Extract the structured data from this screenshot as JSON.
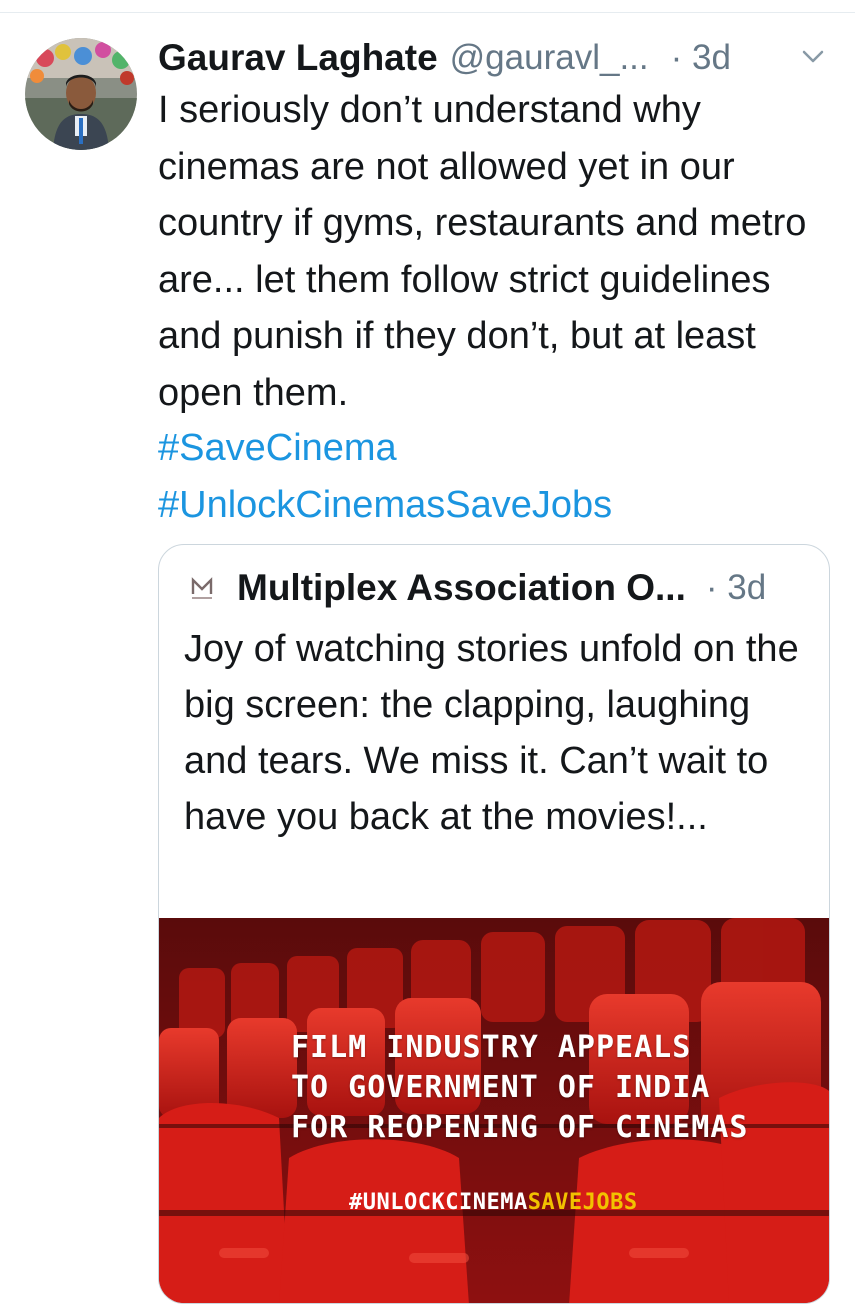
{
  "tweet": {
    "author_name": "Gaurav Laghate",
    "handle": "@gauravl_...",
    "time": "· 3d",
    "text": "I seriously don’t understand why cinemas are not allowed yet in our country if gyms, restaurants and metro are... let them follow strict guidelines and punish if they don’t, but at least open them.",
    "hashtags": [
      "#SaveCinema",
      "#UnlockCinemasSaveJobs"
    ],
    "menu_icon": "chevron-down-icon"
  },
  "quoted_tweet": {
    "author_name": "Multiplex Association O...",
    "time": "· 3d",
    "text": "Joy of watching stories unfold on the big screen: the clapping, laughing and tears. We miss it. Can’t wait to have you back at the movies!...",
    "media": {
      "caption_lines": [
        "FILM INDUSTRY APPEALS",
        "TO GOVERNMENT OF INDIA",
        "FOR REOPENING OF CINEMAS"
      ],
      "hashtag_part1": "#UNLOCKCINEMA",
      "hashtag_part2": "SAVEJOBS"
    }
  },
  "colors": {
    "link": "#1b95e0",
    "secondary_text": "#657786",
    "seat_red": "#d11a1a",
    "hashtag_yellow": "#f2c200"
  }
}
